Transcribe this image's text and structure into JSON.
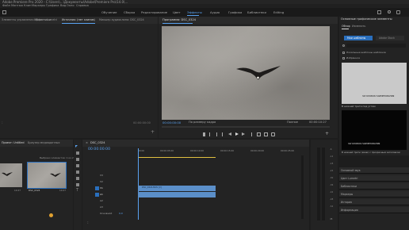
{
  "window": {
    "title": "Adobe Premiere Pro 2020 - C:\\Users\\...\\Документы\\Adobe\\Premiere Pro\\14.0\\...",
    "menu": [
      "Файл",
      "Монтаж",
      "Клип",
      "Маркеры",
      "Графика",
      "Вид",
      "Окно",
      "Справка"
    ]
  },
  "workspace_tabs": [
    "Обучение",
    "Сборка",
    "Редактирование",
    "Цвет",
    "Эффекты",
    "Аудио",
    "Графика",
    "Библиотеки",
    "Editing"
  ],
  "top_left_panel": {
    "tabs": [
      "Элементы управления эффектами",
      "Область Lumetri",
      "Источник: (нет клипов)",
      "Микшер аудиоклипа: DSC_0324"
    ],
    "timecode": "00:00:00:00"
  },
  "program_monitor": {
    "title": "Программа: DSC_0324",
    "timecode": "00:00:00:00",
    "fit": "По размеру кадра",
    "quality": "Полное",
    "duration": "00:00:10:27"
  },
  "essential_graphics": {
    "title": "Основные графические элементы",
    "tabs": [
      "Обзор",
      "Изменить"
    ],
    "my_templates": "Мои шаблоны",
    "adobe_stock": "Adobe Stock",
    "checkboxes": [
      "Локальные шаблоны шаблонов",
      "Избранное"
    ],
    "thumb1_caption": "ЗАГОЛОВОК НАИМЕНОВАНИЯ",
    "label1": "В нижней трети под углом",
    "thumb2_caption": "ЗАГОЛОВОК НАИМЕНОВАНИЯ",
    "label2": "В нижней трети (мини) с прозрачным заголовком"
  },
  "right_list": [
    "Основной звук",
    "Цвет Lumetri",
    "Библиотеки",
    "Маркеры",
    "История",
    "Информация"
  ],
  "project_panel": {
    "tabs": [
      "Проект: Untitled",
      "Браузер медиаданных"
    ],
    "path": "Выбрано элементов: 1 из 2",
    "clips": [
      {
        "name": "DSC_0324",
        "duration": "10:27"
      },
      {
        "name": "DSC_0324",
        "duration": "10:27"
      }
    ]
  },
  "timeline": {
    "tab": "DSC_0324",
    "timecode": "00:00:00:00",
    "ruler": [
      "00:00",
      "00:00:05:00",
      "00:00:10:00",
      "00:00:15:00",
      "00:00:20:00",
      "00:00:25:00"
    ],
    "tracks": [
      "V3",
      "V2",
      "V1",
      "A1",
      "A2",
      "A3"
    ],
    "master": "Основной",
    "master_value": "0,0",
    "video_clip": "DSC_0324.MOV [V]"
  },
  "audio_meter": {
    "labels": [
      "-6",
      "-12",
      "-18",
      "-24",
      "-30",
      "-36",
      "-42",
      "-48",
      "-54",
      "dB"
    ]
  }
}
